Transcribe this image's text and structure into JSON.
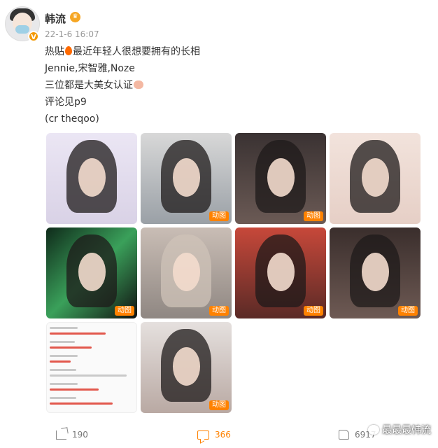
{
  "post": {
    "username": "韩流",
    "verified_badge": "V",
    "timestamp": "22-1-6 16:07",
    "lines": [
      {
        "before_icon": "热贴",
        "after_icon": "最近年轻人很想要拥有的长相"
      },
      {
        "text": "Jennie,宋智雅,Noze"
      },
      {
        "text": "三位都是大美女认证"
      },
      {
        "text": "评论见p9"
      },
      {
        "text": "(cr theqoo)"
      }
    ],
    "gif_label": "动图"
  },
  "actions": {
    "share_count": "190",
    "comment_count": "366",
    "like_count": "6917"
  },
  "watermark": "最最最韩流",
  "colors": {
    "accent": "#ff8200",
    "verified": "#f39800"
  },
  "icons": [
    "fire-icon",
    "pig-icon",
    "share-icon",
    "comment-icon",
    "like-icon",
    "crown-icon"
  ]
}
